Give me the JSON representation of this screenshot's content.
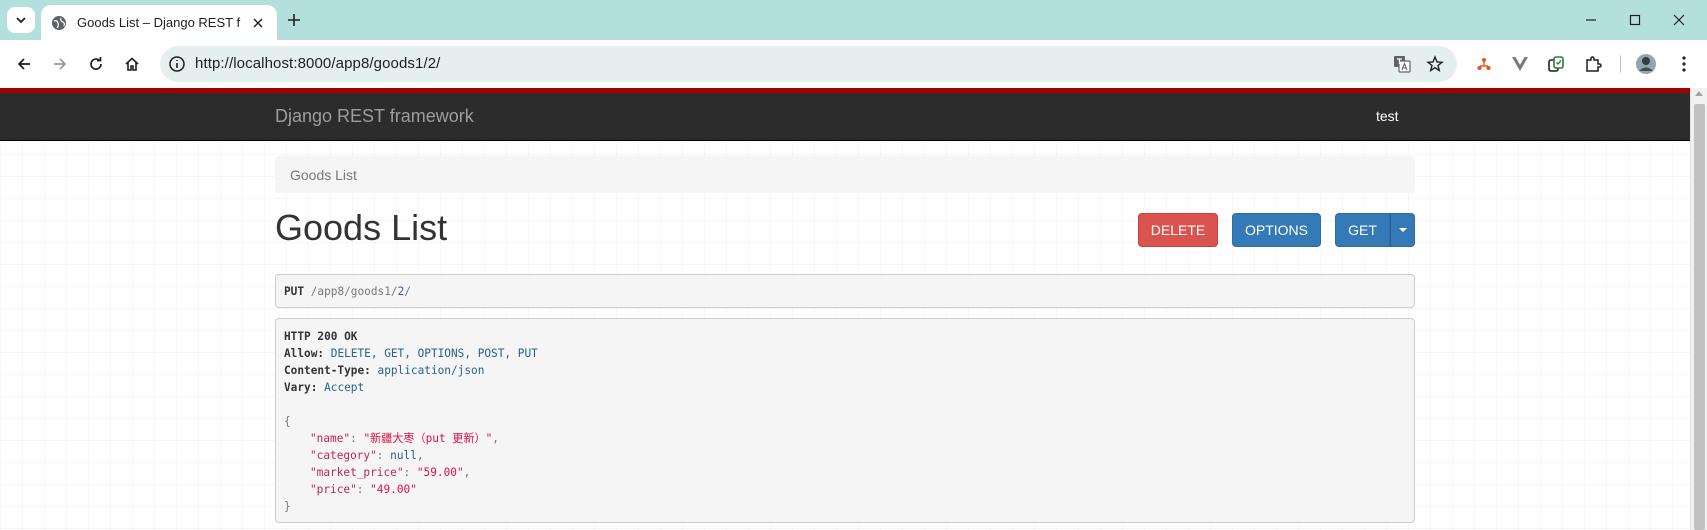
{
  "browser": {
    "tab_title": "Goods List – Django REST fra",
    "url": "http://localhost:8000/app8/goods1/2/"
  },
  "page": {
    "brand": "Django REST framework",
    "user": "test",
    "breadcrumb": "Goods List",
    "title": "Goods List",
    "buttons": {
      "delete": "DELETE",
      "options": "OPTIONS",
      "get": "GET"
    }
  },
  "request": {
    "method": "PUT",
    "path_prefix": "/app8/goods1/",
    "path_id": "2",
    "path_suffix": "/"
  },
  "response": {
    "status": "HTTP 200 OK",
    "headers": [
      {
        "name": "Allow:",
        "value": "DELETE, GET, OPTIONS, POST, PUT"
      },
      {
        "name": "Content-Type:",
        "value": "application/json"
      },
      {
        "name": "Vary:",
        "value": "Accept"
      }
    ],
    "body": [
      {
        "key": "\"name\"",
        "value": "\"新疆大枣（put 更新）\"",
        "comma": ","
      },
      {
        "key": "\"category\"",
        "value": "null",
        "comma": ","
      },
      {
        "key": "\"market_price\"",
        "value": "\"59.00\"",
        "comma": ","
      },
      {
        "key": "\"price\"",
        "value": "\"49.00\"",
        "comma": ""
      }
    ]
  },
  "colors": {
    "navbar": "#2c2c2c",
    "topline": "#a30000",
    "delete": "#d9534f",
    "primary": "#337ab7",
    "browser_frame": "#b3e0dc"
  }
}
